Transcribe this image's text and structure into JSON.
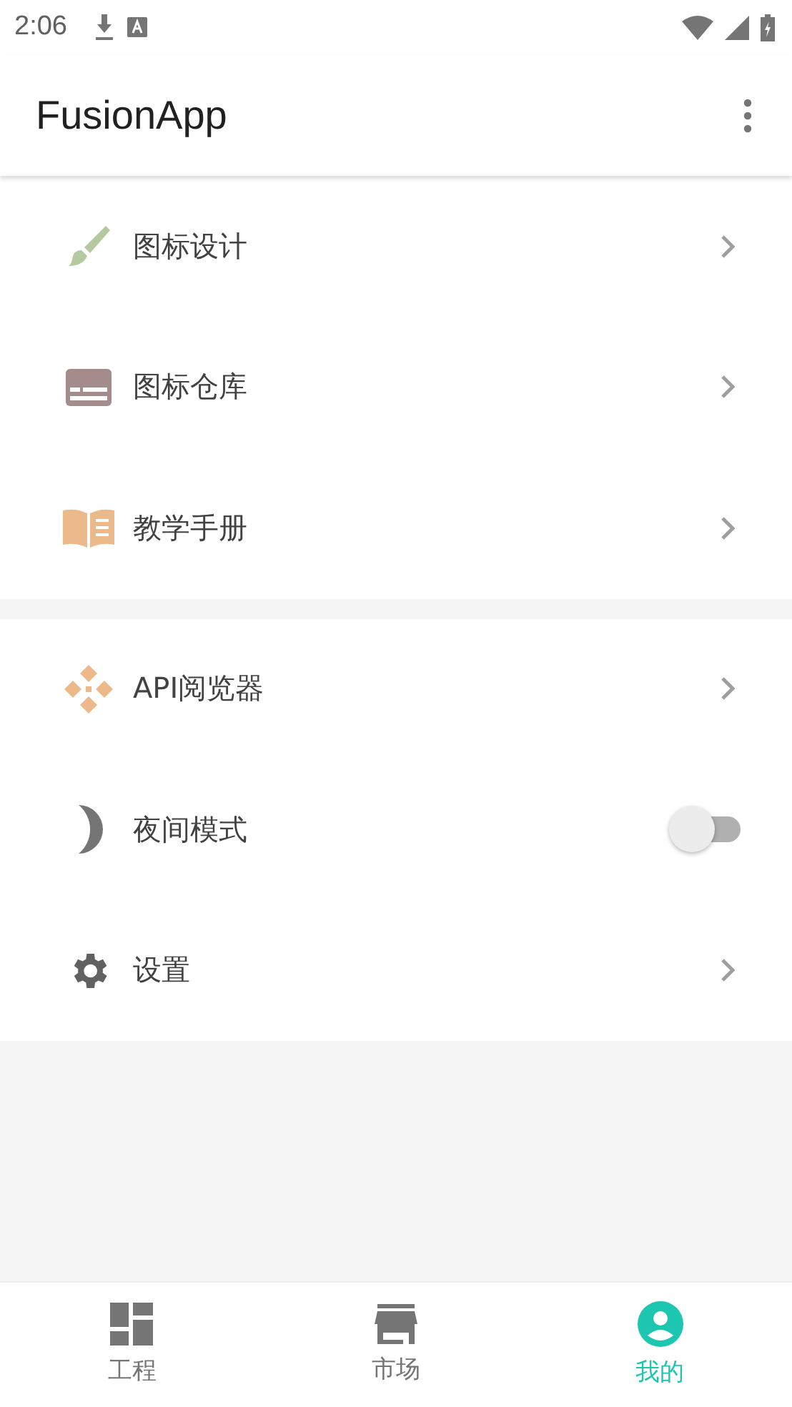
{
  "status_bar": {
    "time": "2:06"
  },
  "app_bar": {
    "title": "FusionApp"
  },
  "groups": [
    {
      "items": [
        {
          "kind": "link",
          "label": "图标设计"
        },
        {
          "kind": "link",
          "label": "图标仓库"
        },
        {
          "kind": "link",
          "label": "教学手册"
        }
      ]
    },
    {
      "items": [
        {
          "kind": "link",
          "label": "API阅览器"
        },
        {
          "kind": "switch",
          "label": "夜间模式",
          "on": false
        },
        {
          "kind": "link",
          "label": "设置"
        }
      ]
    }
  ],
  "bottom_nav": [
    {
      "label": "工程",
      "selected": false
    },
    {
      "label": "市场",
      "selected": false
    },
    {
      "label": "我的",
      "selected": true
    }
  ]
}
